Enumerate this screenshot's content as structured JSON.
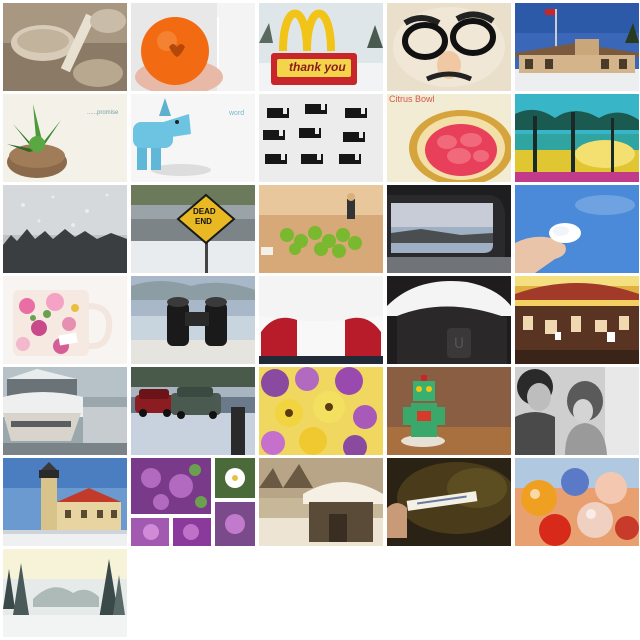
{
  "tiles": {
    "thank_you_sign": "thank you",
    "citrus_bowl": "Citrus Bowl",
    "dead_end_line1": "DEAD",
    "dead_end_line2": "END",
    "promise_caption": "......promise",
    "word_caption": "word"
  },
  "colors": {
    "background": "#ffffff",
    "mcd_yellow": "#f2c418",
    "mcd_red": "#c8262a",
    "sign_yellow": "#e8b923"
  }
}
